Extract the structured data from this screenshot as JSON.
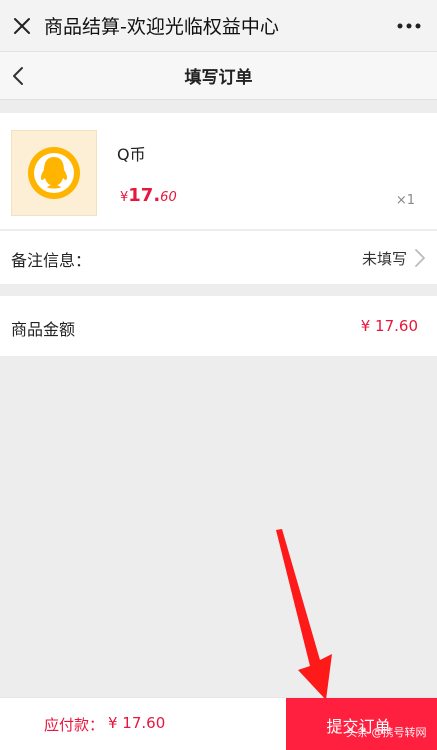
{
  "titlebar": {
    "title": "商品结算-欢迎光临权益中心",
    "close_icon": "close-icon",
    "more_icon": "more-icon"
  },
  "navbar": {
    "title": "填写订单",
    "back_icon": "chevron-left-icon"
  },
  "product": {
    "name": "Q币",
    "price_currency": "¥",
    "price_integer": "17.",
    "price_decimal": "60",
    "quantity": "×1",
    "thumbnail_icon": "qq-penguin-icon"
  },
  "note": {
    "label": "备注信息：",
    "value": "未填写",
    "arrow_icon": "chevron-right-icon"
  },
  "amount": {
    "label": "商品金额",
    "value": "¥ 17.60"
  },
  "footer": {
    "pay_label": "应付款：",
    "pay_value": "¥ 17.60",
    "submit_label": "提交订单"
  },
  "watermark": {
    "text": "头条 @携号转网"
  },
  "colors": {
    "accent": "#ff2040",
    "price": "#e8163d",
    "background": "#ededed"
  }
}
